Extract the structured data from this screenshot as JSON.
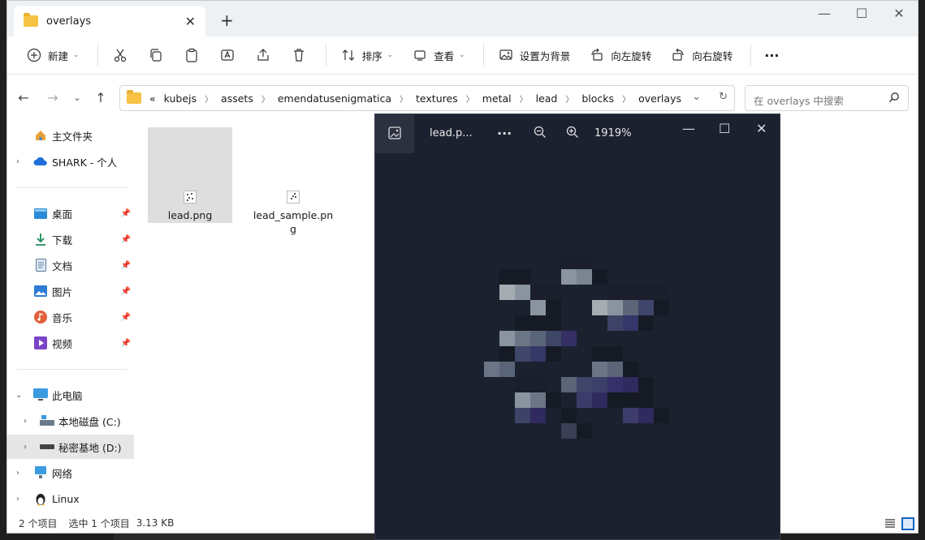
{
  "window": {
    "tab_title": "overlays",
    "tab_close": "✕",
    "new_tab": "+",
    "controls": {
      "minimize": "—",
      "maximize": "☐",
      "close": "✕"
    }
  },
  "toolbar": {
    "new_label": "新建",
    "sort_label": "排序",
    "view_label": "查看",
    "set_background_label": "设置为背景",
    "rotate_left_label": "向左旋转",
    "rotate_right_label": "向右旋转",
    "more_label": "···"
  },
  "address": {
    "overflow": "«",
    "crumbs": [
      "kubejs",
      "assets",
      "emendatusenigmatica",
      "textures",
      "metal",
      "lead",
      "blocks",
      "overlays"
    ],
    "search_placeholder": "在 overlays 中搜索"
  },
  "sidebar": {
    "items": [
      {
        "label": "主文件夹",
        "icon": "home-icon"
      },
      {
        "label": "SHARK - 个人",
        "icon": "cloud-icon"
      },
      {
        "label": "桌面",
        "icon": "desktop-icon"
      },
      {
        "label": "下载",
        "icon": "download-icon"
      },
      {
        "label": "文档",
        "icon": "document-icon"
      },
      {
        "label": "图片",
        "icon": "pictures-icon"
      },
      {
        "label": "音乐",
        "icon": "music-icon"
      },
      {
        "label": "视频",
        "icon": "video-icon"
      },
      {
        "label": "此电脑",
        "icon": "computer-icon"
      },
      {
        "label": "本地磁盘 (C:)",
        "icon": "drive-icon"
      },
      {
        "label": "秘密基地 (D:)",
        "icon": "drive-icon"
      },
      {
        "label": "网络",
        "icon": "network-icon"
      },
      {
        "label": "Linux",
        "icon": "linux-icon"
      }
    ]
  },
  "files": [
    {
      "name": "lead.png"
    },
    {
      "name": "lead_sample.png"
    }
  ],
  "status": {
    "item_count": "2 个项目",
    "selection": "选中 1 个项目",
    "size": "3.13 KB"
  },
  "viewer": {
    "title": "lead.p...",
    "more": "···",
    "zoom": "1919%",
    "controls": {
      "minimize": "—",
      "maximize": "☐",
      "close": "✕"
    }
  },
  "colors": {
    "viewer_bg": "#1c2130",
    "selection_bg": "#dedede",
    "accent": "#1565c0"
  }
}
